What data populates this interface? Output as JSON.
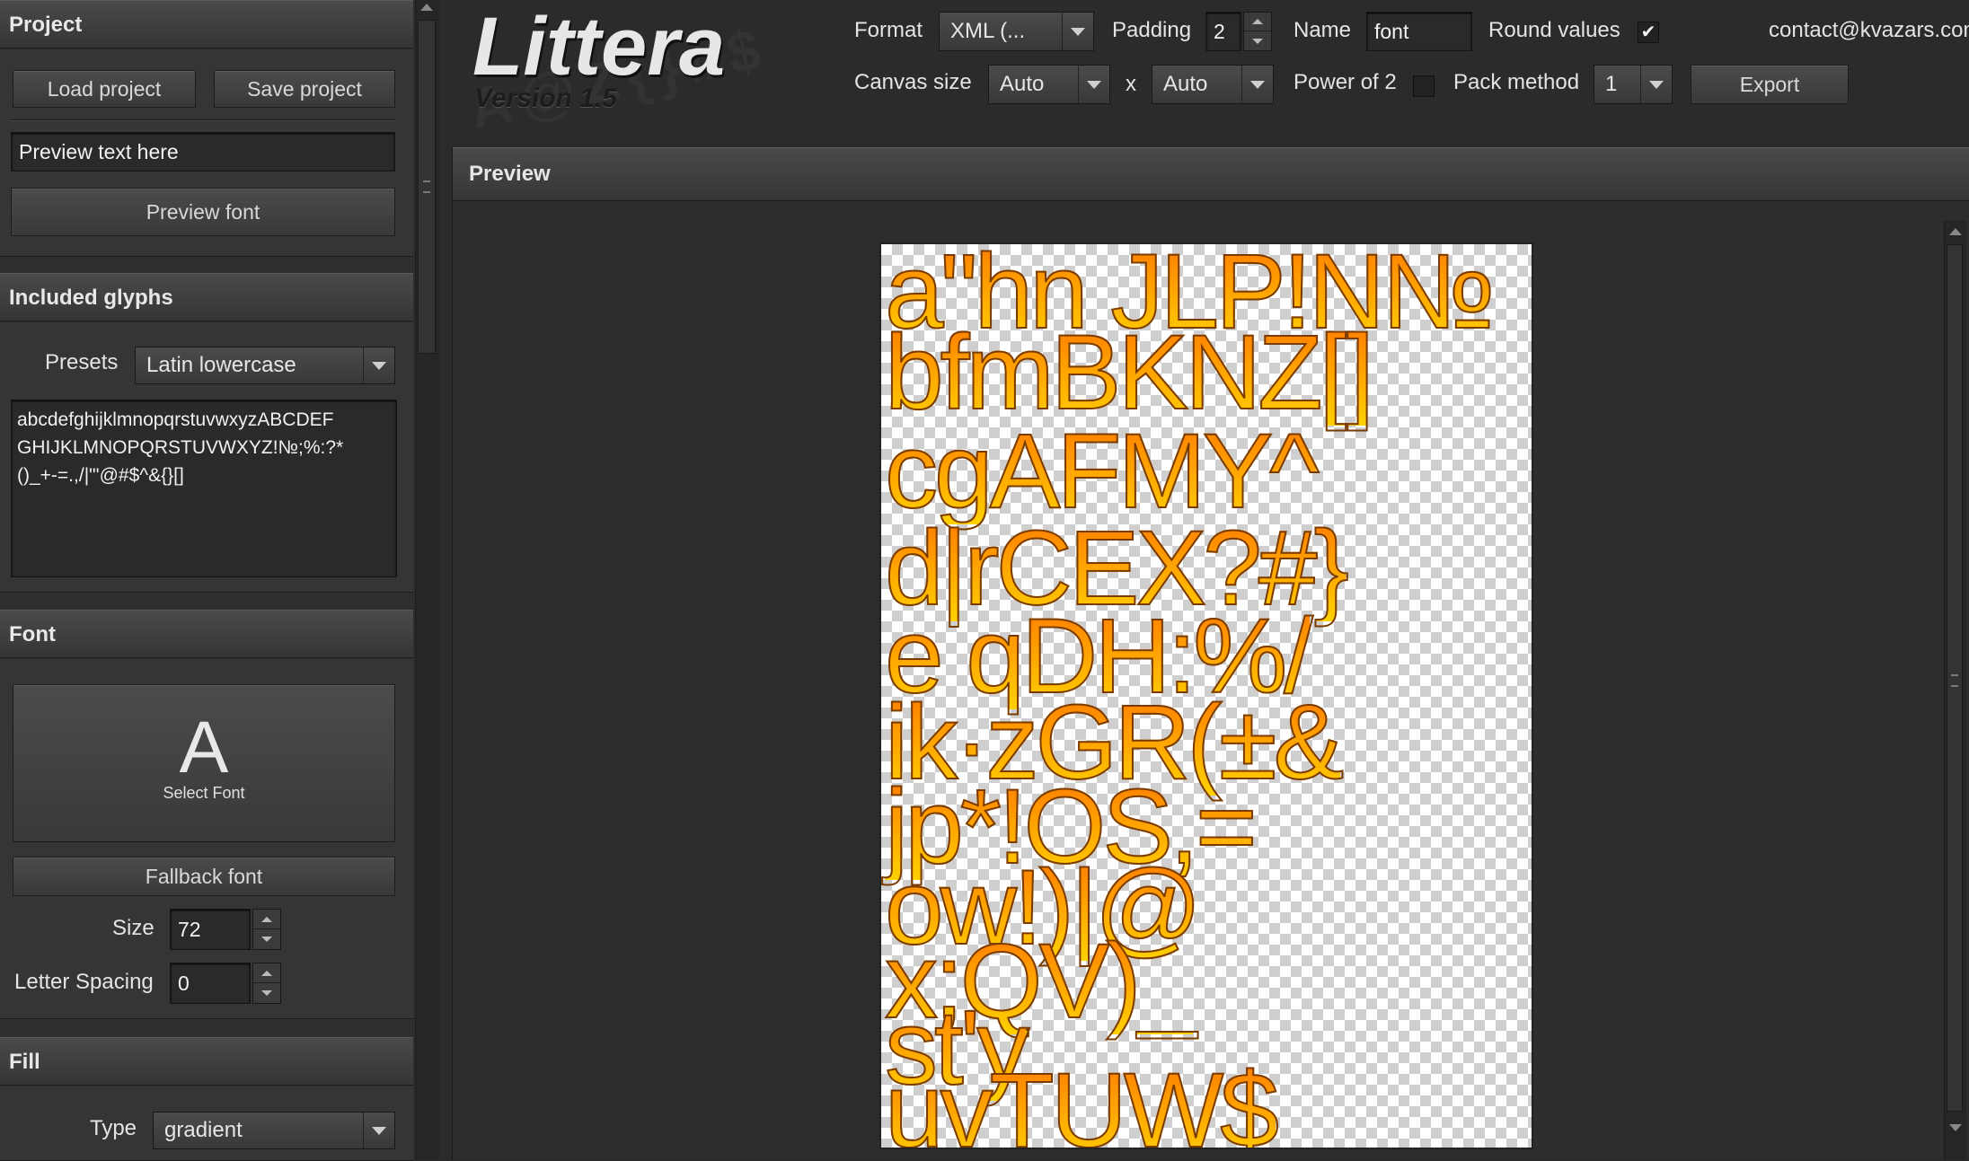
{
  "project": {
    "title": "Project",
    "load_label": "Load project",
    "save_label": "Save project",
    "preview_text_value": "Preview text here",
    "preview_font_label": "Preview font"
  },
  "glyphs": {
    "title": "Included glyphs",
    "presets_label": "Presets",
    "presets_value": "Latin lowercase",
    "text_lines": [
      "abcdefghijklmnopqrstuvwxyzABCDEF",
      "GHIJKLMNOPQRSTUVWXYZ!№;%:?*",
      "()_+-=.,/|\"'@#$^&{}[]"
    ]
  },
  "font": {
    "title": "Font",
    "select_glyph": "A",
    "select_label": "Select Font",
    "fallback_label": "Fallback font",
    "size_label": "Size",
    "size_value": "72",
    "spacing_label": "Letter Spacing",
    "spacing_value": "0"
  },
  "fill": {
    "title": "Fill",
    "type_label": "Type",
    "type_value": "gradient"
  },
  "logo": {
    "name": "Littera",
    "version": "Version 1.5"
  },
  "toolbar": {
    "format_label": "Format",
    "format_value": "XML (...",
    "padding_label": "Padding",
    "padding_value": "2",
    "name_label": "Name",
    "name_value": "font",
    "round_label": "Round values",
    "round_checked": true,
    "contact": "contact@kvazars.com",
    "canvas_label": "Canvas size",
    "canvas_w": "Auto",
    "x_label": "x",
    "canvas_h": "Auto",
    "power_label": "Power of 2",
    "power_checked": false,
    "pack_label": "Pack method",
    "pack_value": "1",
    "export_label": "Export"
  },
  "preview": {
    "title": "Preview",
    "rows": [
      "a\"hn  JLP!N№",
      "bfmBKNZ[]",
      "cgAFMY^",
      "d|rCEX?#}",
      "e qDH:%/",
      "ik·zGR(±&",
      "jp*!OS,=",
      "ow!)|@",
      "x;QV)_",
      "st'y",
      "uvTUW$"
    ]
  },
  "colors": {
    "accent_orange": "#ff9d12",
    "gradient_top": "#ff7a00",
    "gradient_bottom": "#ffd100"
  }
}
